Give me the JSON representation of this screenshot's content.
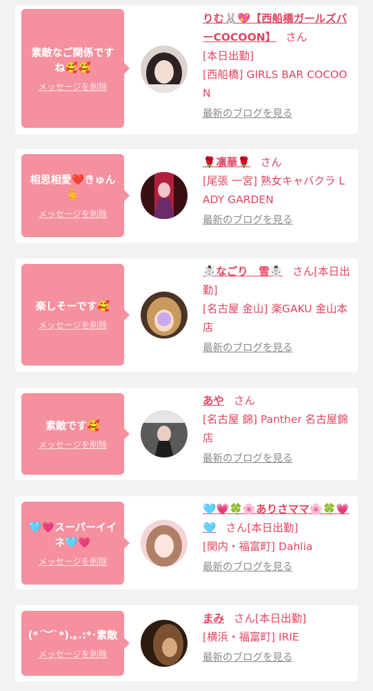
{
  "colors": {
    "page_bg": "#f2f2f2",
    "card_bg": "#ffffff",
    "bubble_bg": "#f5909e",
    "accent_text": "#e2455f",
    "muted_text": "#8a8a8a"
  },
  "cards": [
    {
      "message": "素敵なご関係ですね🥰🥰",
      "delete_label": "メッセージを削除",
      "name": "りむ🐰💖【西船橋ガールズバーCOCOON】",
      "honorific": "さん",
      "shop": "[本日出勤]",
      "shop2": "[西船橋] GIRLS BAR COCOON",
      "blog_label": "最新のブログを見る",
      "avatar_icon": "avatar-photo"
    },
    {
      "message": "相思相愛❤️きゅん🫰",
      "delete_label": "メッセージを削除",
      "name": "🌹凛華🌹",
      "honorific": "さん",
      "shop": "",
      "shop2": "[尾張 一宮] 熟女キャバクラ LADY GARDEN",
      "blog_label": "最新のブログを見る",
      "avatar_icon": "avatar-photo"
    },
    {
      "message": "楽しそーです🥰",
      "delete_label": "メッセージを削除",
      "name": "☃️なごり　雪☃️",
      "honorific": "さん[本日出勤]",
      "shop": "",
      "shop2": "[名古屋 金山] 楽GAKU 金山本店",
      "blog_label": "最新のブログを見る",
      "avatar_icon": "avatar-photo"
    },
    {
      "message": "素敵です🥰",
      "delete_label": "メッセージを削除",
      "name": "あや",
      "honorific": "さん",
      "shop": "",
      "shop2": "[名古屋 錦] Panther 名古屋錦店",
      "blog_label": "最新のブログを見る",
      "avatar_icon": "avatar-photo"
    },
    {
      "message": "🩵💗スーパーイイネ🩵💗",
      "delete_label": "メッセージを削除",
      "name": "🩵💗🍀🌸ありさママ🌸🍀💗🩵",
      "honorific": "さん[本日出勤]",
      "shop": "",
      "shop2": "[関内・福富町] Dahlia",
      "blog_label": "最新のブログを見る",
      "avatar_icon": "avatar-photo"
    },
    {
      "message": "(*´︶`*).｡.:*･素敵",
      "delete_label": "メッセージを削除",
      "name": "まみ",
      "honorific": "さん[本日出勤]",
      "shop": "",
      "shop2": "[横浜・福富町] IRIE",
      "blog_label": "最新のブログを見る",
      "avatar_icon": "avatar-photo"
    }
  ]
}
